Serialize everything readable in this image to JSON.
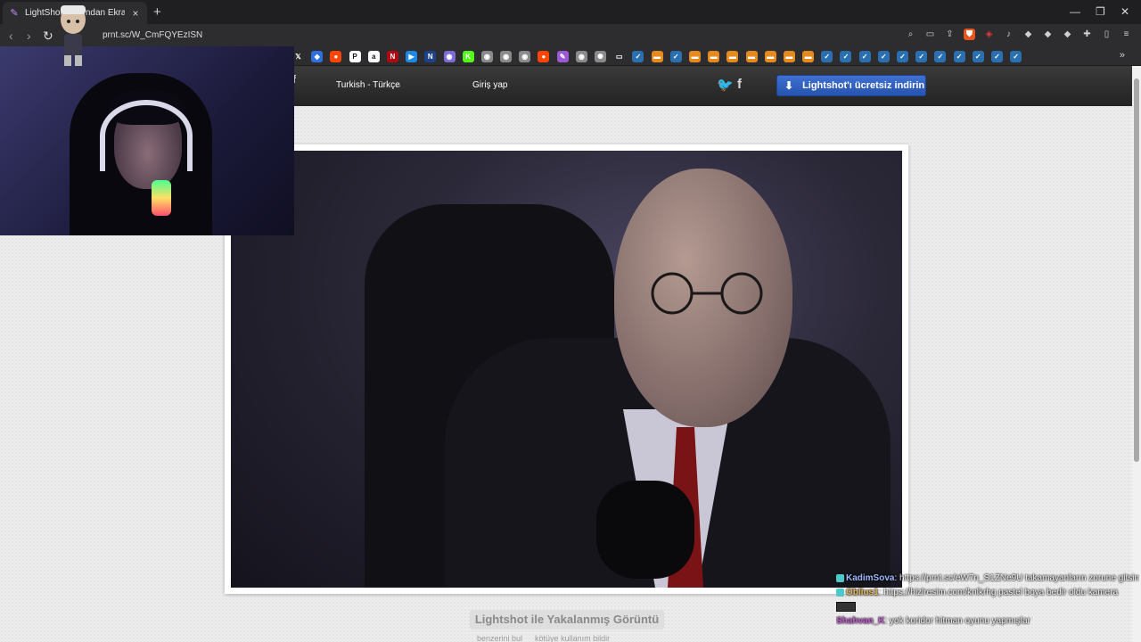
{
  "browser": {
    "tab": {
      "title": "LightShot tarafından Ekran Görüntüsü",
      "favicon": "lightshot-feather-icon"
    },
    "url": "prnt.sc/W_CmFQYEzISN",
    "window_controls": [
      "minimize-icon",
      "restore-icon",
      "close-icon"
    ],
    "toolbar_icons": [
      "zoom-icon",
      "cast-icon",
      "share-icon",
      "brave-shield-icon",
      "ublock-icon",
      "audio-icon",
      "extension-icon",
      "extension-icon",
      "extension-icon",
      "extensions-puzzle-icon",
      "sidebar-icon",
      "menu-icon"
    ],
    "bookmarks": [
      {
        "icon": "x-twitter-icon",
        "color": "#2d2d30",
        "glyph": "𝕏"
      },
      {
        "icon": "blue-app-icon",
        "color": "#2f6fe0",
        "glyph": "◆"
      },
      {
        "icon": "reddit-icon",
        "color": "#ff4500",
        "glyph": "●"
      },
      {
        "icon": "p-icon",
        "color": "#ffffff",
        "glyph": "P"
      },
      {
        "icon": "amazon-icon",
        "color": "#ffffff",
        "glyph": "a"
      },
      {
        "icon": "netflix-icon",
        "color": "#b20710",
        "glyph": "N"
      },
      {
        "icon": "play-icon",
        "color": "#1e88e5",
        "glyph": "▶"
      },
      {
        "icon": "nba-icon",
        "color": "#1d428a",
        "glyph": "N"
      },
      {
        "icon": "globe-icon",
        "color": "#7d6cd8",
        "glyph": "◉"
      },
      {
        "icon": "kick-icon",
        "color": "#53fc18",
        "glyph": "K"
      },
      {
        "icon": "globe-icon",
        "color": "#8a8a8a",
        "glyph": "◉"
      },
      {
        "icon": "globe-icon",
        "color": "#8a8a8a",
        "glyph": "◉"
      },
      {
        "icon": "globe-icon",
        "color": "#8a8a8a",
        "glyph": "◉"
      },
      {
        "icon": "reddit-icon",
        "color": "#ff4500",
        "glyph": "●"
      },
      {
        "icon": "lightshot-icon",
        "color": "#9b59d6",
        "glyph": "✎"
      },
      {
        "icon": "globe-icon",
        "color": "#8a8a8a",
        "glyph": "◉"
      },
      {
        "icon": "openai-icon",
        "color": "#8a8a8a",
        "glyph": "✺"
      },
      {
        "icon": "folder-icon",
        "color": "#2d2d30",
        "glyph": "▭"
      },
      {
        "icon": "steam-icon",
        "color": "#2a6fb0",
        "glyph": "✓"
      },
      {
        "icon": "orange-app-icon",
        "color": "#e58a1f",
        "glyph": "▬"
      },
      {
        "icon": "steam-icon",
        "color": "#2a6fb0",
        "glyph": "✓"
      },
      {
        "icon": "orange-app-icon",
        "color": "#e58a1f",
        "glyph": "▬"
      },
      {
        "icon": "orange-app-icon",
        "color": "#e58a1f",
        "glyph": "▬"
      },
      {
        "icon": "orange-app-icon",
        "color": "#e58a1f",
        "glyph": "▬"
      },
      {
        "icon": "orange-app-icon",
        "color": "#e58a1f",
        "glyph": "▬"
      },
      {
        "icon": "orange-app-icon",
        "color": "#e58a1f",
        "glyph": "▬"
      },
      {
        "icon": "orange-app-icon",
        "color": "#e58a1f",
        "glyph": "▬"
      },
      {
        "icon": "orange-app-icon",
        "color": "#e58a1f",
        "glyph": "▬"
      },
      {
        "icon": "steam-icon",
        "color": "#2a6fb0",
        "glyph": "✓"
      },
      {
        "icon": "steam-icon",
        "color": "#2a6fb0",
        "glyph": "✓"
      },
      {
        "icon": "steam-icon",
        "color": "#2a6fb0",
        "glyph": "✓"
      },
      {
        "icon": "steam-icon",
        "color": "#2a6fb0",
        "glyph": "✓"
      },
      {
        "icon": "steam-icon",
        "color": "#2a6fb0",
        "glyph": "✓"
      },
      {
        "icon": "steam-icon",
        "color": "#2a6fb0",
        "glyph": "✓"
      },
      {
        "icon": "steam-icon",
        "color": "#2a6fb0",
        "glyph": "✓"
      },
      {
        "icon": "steam-icon",
        "color": "#2a6fb0",
        "glyph": "✓"
      },
      {
        "icon": "steam-icon",
        "color": "#2a6fb0",
        "glyph": "✓"
      },
      {
        "icon": "steam-icon",
        "color": "#2a6fb0",
        "glyph": "✓"
      },
      {
        "icon": "steam-icon",
        "color": "#2a6fb0",
        "glyph": "✓"
      }
    ]
  },
  "site": {
    "language": "Turkish - Türkçe",
    "login": "Giriş yap",
    "download_button": "Lightshot'ı ücretsiz indirin",
    "accent": "#2f5fc4",
    "caption": "Lightshot ile Yakalanmış Görüntü",
    "actions": [
      "benzerini bul",
      "kötüye kullanım bildir"
    ]
  },
  "chat": [
    {
      "user": "KadimSova",
      "text": ": https://prnt.sc/eW7n_S1ZNe9U takamayanların zorune gitsin bral"
    },
    {
      "user": "Oblius1",
      "text": ": https://hizlresim.com/knlkrhg pastel boya bedir oldu kamera"
    },
    {
      "user": "Shahvan_K",
      "text": ": yok koridor hitman oyunu yapmışlar"
    }
  ]
}
